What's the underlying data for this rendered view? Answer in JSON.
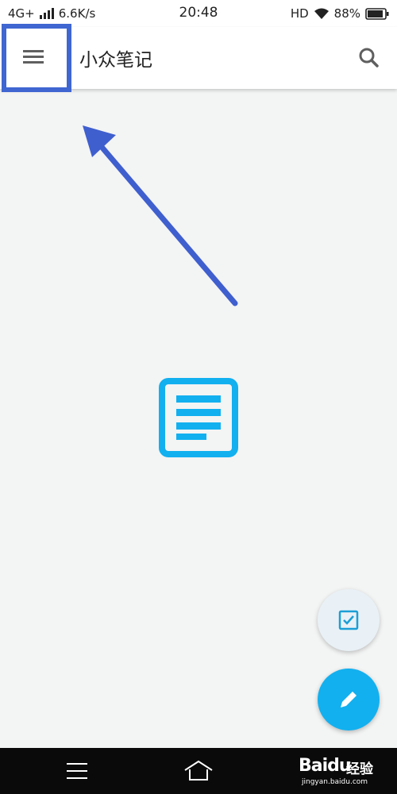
{
  "status_bar": {
    "network": "4G+",
    "speed": "6.6K/s",
    "time": "20:48",
    "hd": "HD",
    "battery": "88%"
  },
  "app_bar": {
    "title": "小众笔记"
  },
  "icons": {
    "menu": "hamburger-menu-icon",
    "search": "search-icon",
    "empty": "note-document-icon",
    "todo": "checkbox-icon",
    "edit": "pencil-icon",
    "nav_menu": "menu-lines-icon",
    "nav_home": "home-icon"
  },
  "colors": {
    "highlight": "#3f66d1",
    "accent": "#12b0ef",
    "background": "#f3f4f4"
  },
  "watermark": {
    "logo": "Bai",
    "logo_suffix": "du",
    "name": "经验",
    "url": "jingyan.baidu.com"
  }
}
